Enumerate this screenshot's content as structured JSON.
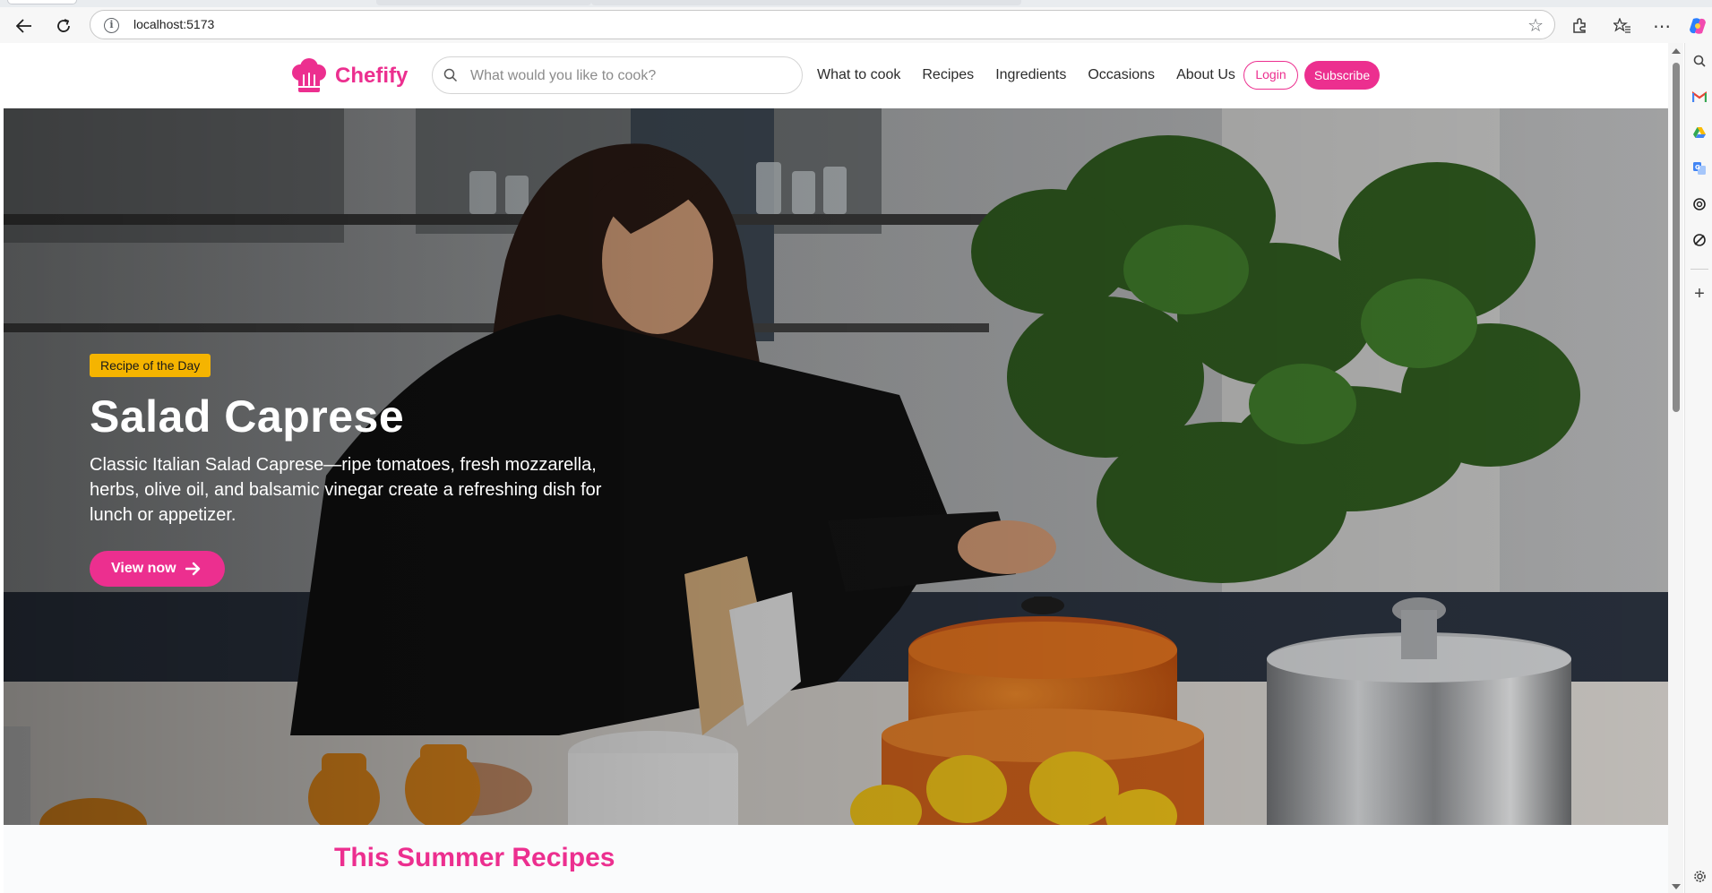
{
  "browser": {
    "url": "localhost:5173",
    "accent_color": "#ec2f8f",
    "toolbar_icons": [
      "back-icon",
      "reload-icon",
      "info-icon",
      "star-icon",
      "extensions-icon",
      "favorites-icon",
      "more-icon",
      "copilot-icon"
    ],
    "sidebar_icons": [
      "search-icon",
      "gmail-icon",
      "drive-icon",
      "translate-icon",
      "chatgpt-icon",
      "no-entry-icon",
      "add-icon",
      "settings-icon"
    ]
  },
  "header": {
    "brand": "Chefify",
    "search_placeholder": "What would you like to cook?",
    "nav": [
      "What to cook",
      "Recipes",
      "Ingredients",
      "Occasions",
      "About Us"
    ],
    "login_label": "Login",
    "subscribe_label": "Subscribe"
  },
  "hero": {
    "badge": "Recipe of the Day",
    "title": "Salad Caprese",
    "description": "Classic Italian Salad Caprese—ripe tomatoes, fresh mozzarella, herbs, olive oil, and balsamic vinegar create a refreshing dish for lunch or appetizer.",
    "cta_label": "View now",
    "badge_color": "#f5b400"
  },
  "sections": {
    "summer_title": "This Summer Recipes"
  }
}
